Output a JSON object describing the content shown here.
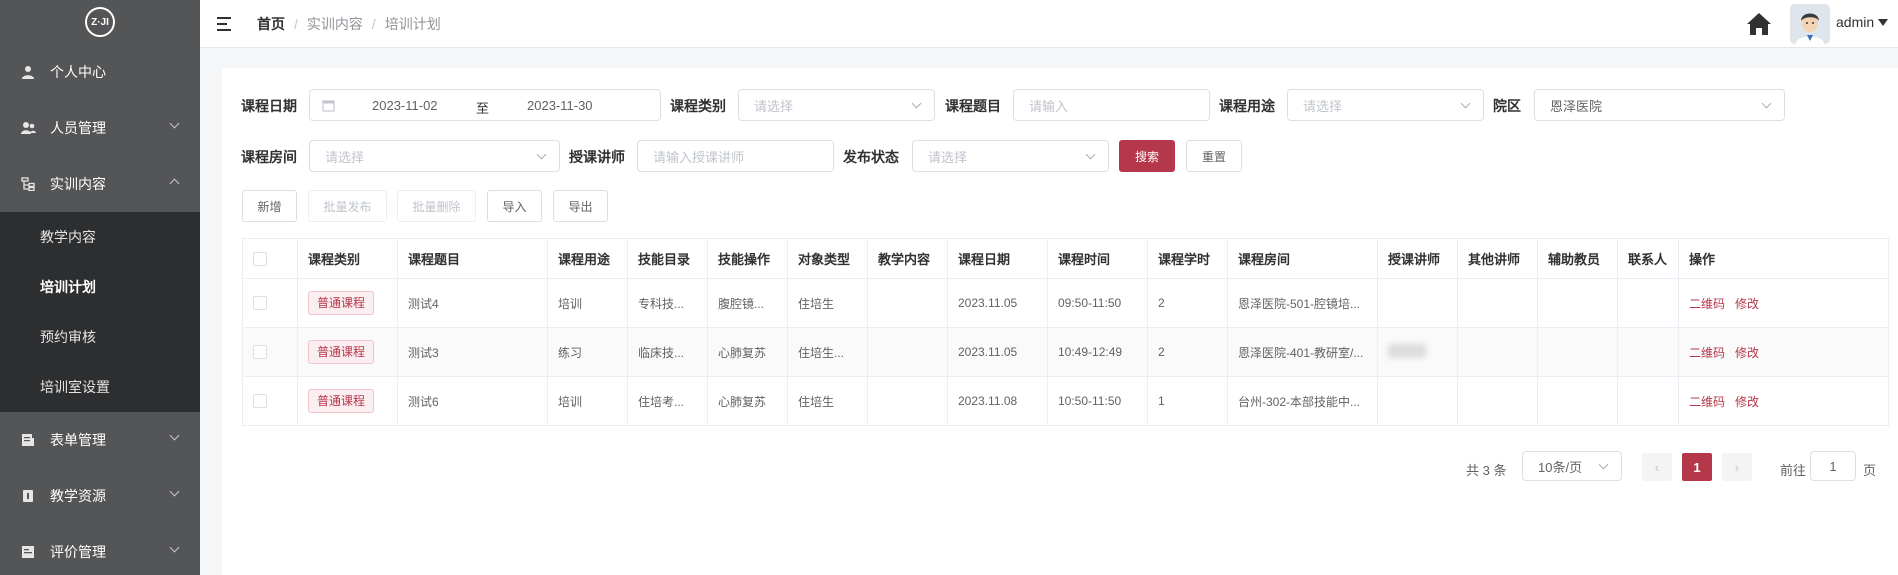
{
  "sidebar": {
    "logo": "Z·JI",
    "items": [
      {
        "label": "个人中心"
      },
      {
        "label": "人员管理"
      },
      {
        "label": "实训内容"
      },
      {
        "label": "表单管理"
      },
      {
        "label": "教学资源"
      },
      {
        "label": "评价管理"
      }
    ],
    "subitems": [
      {
        "label": "教学内容"
      },
      {
        "label": "培训计划"
      },
      {
        "label": "预约审核"
      },
      {
        "label": "培训室设置"
      }
    ]
  },
  "header": {
    "breadcrumb": [
      "首页",
      "实训内容",
      "培训计划"
    ],
    "separator": "/",
    "username": "admin"
  },
  "filters": {
    "date_label": "课程日期",
    "date_start": "2023-11-02",
    "date_to": "至",
    "date_end": "2023-11-30",
    "category_label": "课程类别",
    "category_placeholder": "请选择",
    "topic_label": "课程题目",
    "topic_placeholder": "请输入",
    "usage_label": "课程用途",
    "usage_placeholder": "请选择",
    "campus_label": "院区",
    "campus_value": "恩泽医院",
    "room_label": "课程房间",
    "room_placeholder": "请选择",
    "lecturer_label": "授课讲师",
    "lecturer_placeholder": "请输入授课讲师",
    "status_label": "发布状态",
    "status_placeholder": "请选择",
    "search": "搜索",
    "reset": "重置"
  },
  "toolbar": {
    "add": "新增",
    "batch_publish": "批量发布",
    "batch_delete": "批量删除",
    "import": "导入",
    "export": "导出"
  },
  "table": {
    "columns": [
      "课程类别",
      "课程题目",
      "课程用途",
      "技能目录",
      "技能操作",
      "对象类型",
      "教学内容",
      "课程日期",
      "课程时间",
      "课程学时",
      "课程房间",
      "授课讲师",
      "其他讲师",
      "辅助教员",
      "联系人",
      "操作"
    ],
    "rows": [
      {
        "category": "普通课程",
        "topic": "测试4",
        "usage": "培训",
        "skill_dir": "专科技...",
        "skill_op": "腹腔镜...",
        "target": "住培生",
        "content": "",
        "date": "2023.11.05",
        "time": "09:50-11:50",
        "hours": "2",
        "room": "恩泽医院-501-腔镜培...",
        "lecturer": "",
        "other": "",
        "assistant": "",
        "contact": "",
        "op1": "二维码",
        "op2": "修改"
      },
      {
        "category": "普通课程",
        "topic": "测试3",
        "usage": "练习",
        "skill_dir": "临床技...",
        "skill_op": "心肺复苏",
        "target": "住培生...",
        "content": "",
        "date": "2023.11.05",
        "time": "10:49-12:49",
        "hours": "2",
        "room": "恩泽医院-401-教研室/...",
        "lecturer": "",
        "other": "",
        "assistant": "",
        "contact": "",
        "op1": "二维码",
        "op2": "修改"
      },
      {
        "category": "普通课程",
        "topic": "测试6",
        "usage": "培训",
        "skill_dir": "住培考...",
        "skill_op": "心肺复苏",
        "target": "住培生",
        "content": "",
        "date": "2023.11.08",
        "time": "10:50-11:50",
        "hours": "1",
        "room": "台州-302-本部技能中...",
        "lecturer": "",
        "other": "",
        "assistant": "",
        "contact": "",
        "op1": "二维码",
        "op2": "修改"
      }
    ]
  },
  "pagination": {
    "total": "共 3 条",
    "page_size": "10条/页",
    "current": "1",
    "goto_label": "前往",
    "goto_value": "1",
    "page_suffix": "页"
  },
  "colors": {
    "accent": "#b5374a",
    "sidebar_bg": "#545557",
    "submenu_bg": "#2d2e30"
  }
}
